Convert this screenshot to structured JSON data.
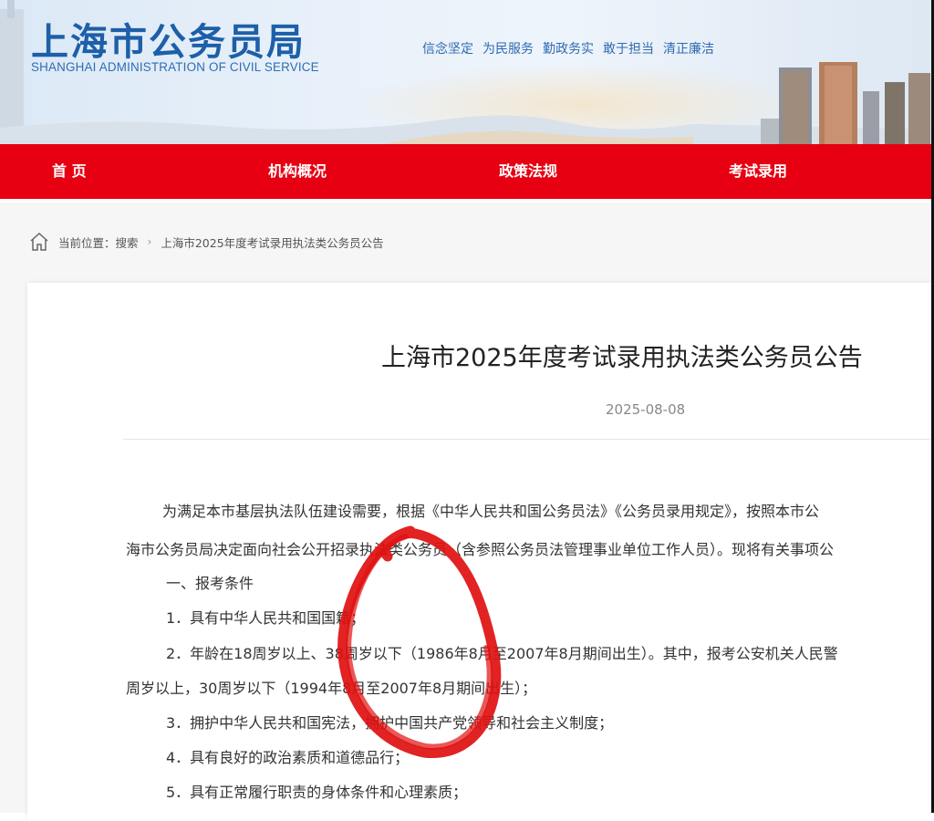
{
  "header": {
    "title": "上海市公务员局",
    "subtitle": "SHANGHAI ADMINISTRATION OF CIVIL SERVICE",
    "slogans": [
      "信念坚定",
      "为民服务",
      "勤政务实",
      "敢于担当",
      "清正廉洁"
    ]
  },
  "nav": {
    "items": [
      "首 页",
      "机构概况",
      "政策法规",
      "考试录用"
    ]
  },
  "breadcrumb": {
    "label": "当前位置：",
    "items": [
      "搜索",
      "上海市2025年度考试录用执法类公务员公告"
    ]
  },
  "article": {
    "title": "上海市2025年度考试录用执法类公务员公告",
    "date": "2025-08-08",
    "paragraphs": [
      "为满足本市基层执法队伍建设需要，根据《中华人民共和国公务员法》《公务员录用规定》，按照本市公",
      "海市公务员局决定面向社会公开招录执法类公务员（含参照公务员法管理事业单位工作人员）。现将有关事项公",
      "一、报考条件",
      "1．具有中华人民共和国国籍；",
      "2．年龄在18周岁以上、38周岁以下（1986年8月至2007年8月期间出生）。其中，报考公安机关人民警",
      "周岁以上，30周岁以下（1994年8月至2007年8月期间出生）；",
      "3．拥护中华人民共和国宪法，拥护中国共产党领导和社会主义制度；",
      "4．具有良好的政治素质和道德品行；",
      "5．具有正常履行职责的身体条件和心理素质；"
    ]
  },
  "colors": {
    "nav_bg": "#e60012",
    "title_blue": "#1d5fa8",
    "annotation": "#e01010"
  }
}
